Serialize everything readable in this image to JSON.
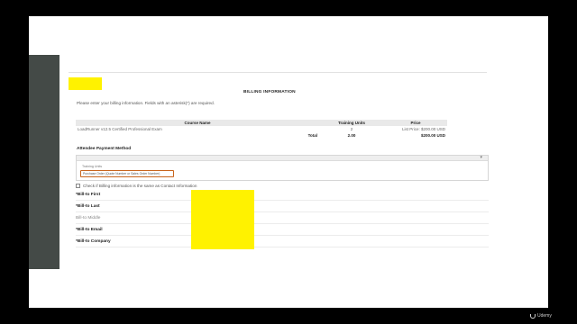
{
  "heading": "BILLING INFORMATION",
  "instructions": "Please enter your billing information. Fields with an asterisk(*) are required.",
  "table": {
    "headers": [
      "Course Name",
      "Training Units",
      "Price"
    ],
    "rows": [
      {
        "name": "LoadRunner v12.5 Certified Professional Exam",
        "units": "2",
        "price": "List Price: $200.00 USD"
      }
    ],
    "total": {
      "label": "Total",
      "units": "2.00",
      "price": "$200.00 USD"
    }
  },
  "payment": {
    "title": "Attendee Payment Method",
    "field_label": "Training Units",
    "selected_option": "Purchase Order (Quote Number or Sales Order Number)"
  },
  "same_as_contact": "Check if Billing information is the same as Contact Information",
  "fields": [
    {
      "label": "*Bill-to First"
    },
    {
      "label": "*Bill-to Last"
    },
    {
      "label": "Bill-to Middle"
    },
    {
      "label": "*Bill-to Email"
    },
    {
      "label": "*Bill-to Company"
    }
  ],
  "brand": "Udemy",
  "colors": {
    "redaction": "#fff200",
    "select_border": "#c8641c",
    "side_bar": "#444a47"
  }
}
